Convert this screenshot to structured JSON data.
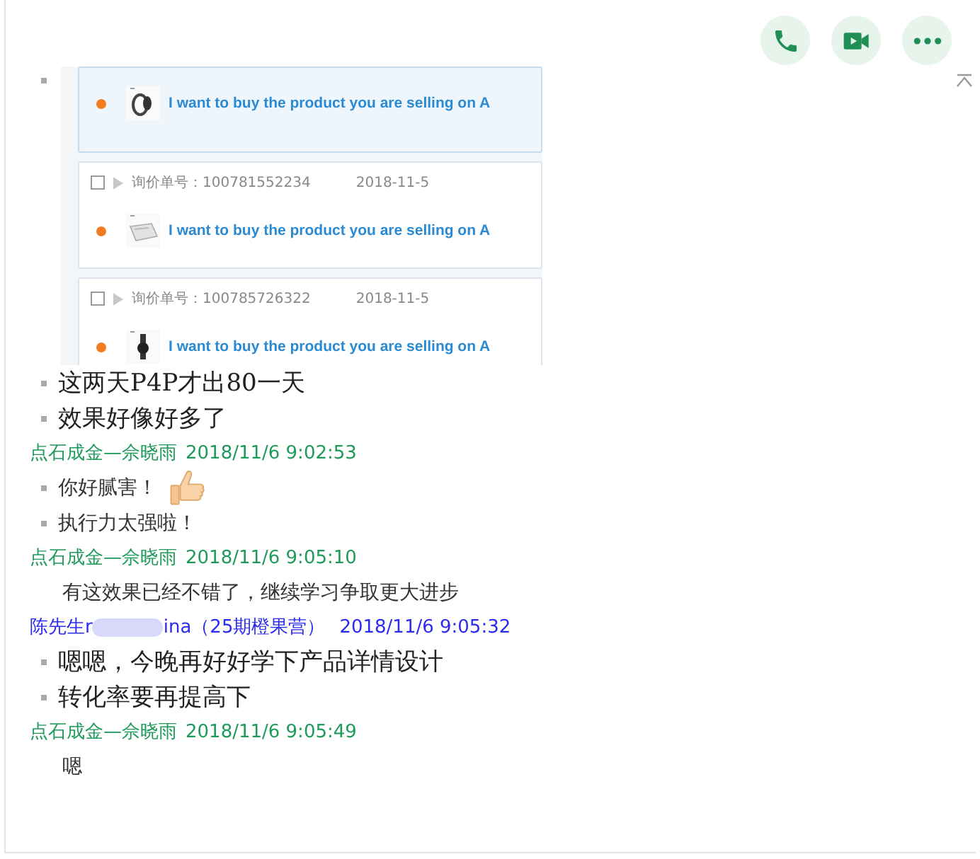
{
  "toolbar": {
    "buttons": [
      {
        "kind": "call"
      },
      {
        "kind": "video"
      },
      {
        "kind": "more"
      }
    ]
  },
  "messages": [
    {
      "lines": [
        {
          "cards": [
            {
              "selected": true,
              "message": "I want to buy the product you are selling on A",
              "kind": "band"
            },
            {
              "selected": false,
              "checked": false,
              "number": "询价单号：100781552234",
              "date": "2018-11-5",
              "message": "I want to buy the product you are selling on A",
              "kind": "sheet"
            },
            {
              "selected": false,
              "checked": false,
              "number": "询价单号：100785726322",
              "date": "2018-11-5",
              "message": "I want to buy the product you are selling on A",
              "kind": "watch"
            }
          ]
        },
        {
          "kind": "bullet",
          "text": "这两天P4P才出80一天"
        },
        {
          "kind": "bullet",
          "text": "效果好像好多了"
        }
      ]
    },
    {
      "sender": {
        "color": "#1e9a5a",
        "name": "点石成金—佘晓雨",
        "time": "2018/11/6 9:02:53"
      },
      "lines": [
        {
          "kind": "point",
          "text": "你好腻害！",
          "thumbs_up": true
        },
        {
          "kind": "point",
          "text": "执行力太强啦！"
        }
      ]
    },
    {
      "sender": {
        "color": "#1e9a5a",
        "name": "点石成金—佘晓雨",
        "time": "2018/11/6 9:05:10"
      },
      "lines": [
        {
          "kind": "plain",
          "text": "有这效果已经不错了，继续学习争取更大进步"
        }
      ]
    },
    {
      "sender": {
        "color": "#2a2af0",
        "name": "陈先生r",
        "name_end": "ina（25期橙果营）",
        "blurred": true,
        "time": "2018/11/6 9:05:32"
      },
      "lines": [
        {
          "kind": "bullet",
          "text": "嗯嗯，今晚再好好学下产品详情设计"
        },
        {
          "kind": "bullet",
          "text": "转化率要再提高下"
        }
      ]
    },
    {
      "sender": {
        "color": "#1e9a5a",
        "name": "点石成金—佘晓雨",
        "time": "2018/11/6 9:05:49"
      },
      "lines": [
        {
          "kind": "plain",
          "text": "嗯"
        }
      ]
    }
  ]
}
